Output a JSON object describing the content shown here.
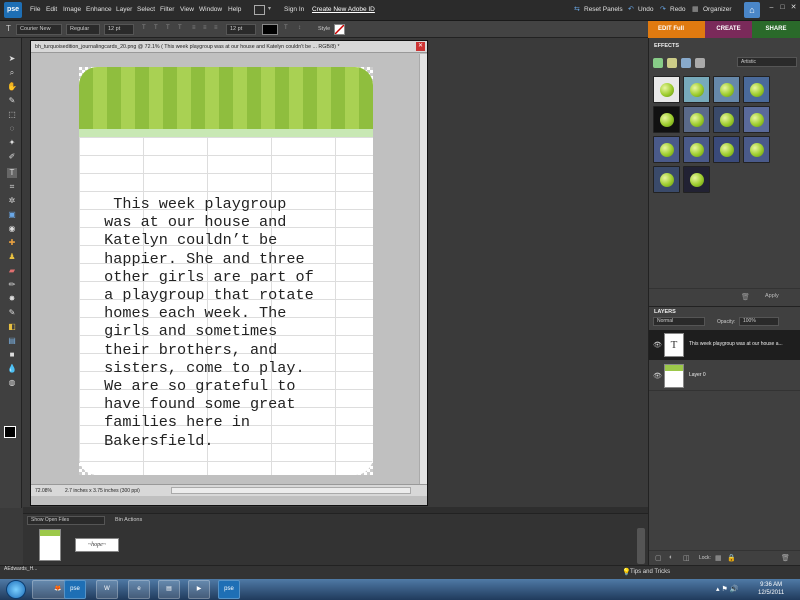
{
  "app": {
    "logo": "pse",
    "menus": [
      "File",
      "Edit",
      "Image",
      "Enhance",
      "Layer",
      "Select",
      "Filter",
      "View",
      "Window",
      "Help"
    ],
    "sign_in": "Sign In",
    "create_id": "Create New Adobe ID",
    "reset_panels": "Reset Panels",
    "undo": "Undo",
    "redo": "Redo",
    "organizer": "Organizer",
    "mode_tabs": [
      "EDIT Full",
      "CREATE",
      "SHARE"
    ]
  },
  "options": {
    "font_family": "Courier New",
    "font_style": "Regular",
    "font_size": "12 pt",
    "leading": "12 pt",
    "style_label": "Style"
  },
  "document": {
    "title": "bh_turquoisedition_journalingcards_20.png @ 72.1% ( This week playgroup was at our house and Katelyn couldn't be ... RGB/8) *",
    "zoom": "72.08%",
    "size": "2.7 inches x 3.75 inches (300 ppi)",
    "journal_text": "  This week playgroup\n was at our house and\n Katelyn couldn’t be\n happier. She and three\n other girls are part of\n a playgroup that rotate\n homes each week. The\n girls and sometimes\n their brothers, and\n sisters, come to play.\n We are so grateful to\n have found some great\n families here in\n Bakersfield."
  },
  "bin": {
    "select": "Show Open Files",
    "actions": "Bin Actions",
    "thumb2_text": "~hope~"
  },
  "effects": {
    "title": "EFFECTS",
    "category": "Artistic",
    "apply": "Apply"
  },
  "layers": {
    "title": "LAYERS",
    "blend": "Normal",
    "opacity_label": "Opacity:",
    "opacity": "100%",
    "items": [
      {
        "name": "This week playgroup was at our house a..."
      },
      {
        "name": "Layer 0"
      }
    ],
    "lock": "Lock:"
  },
  "status": {
    "tips": "Tips and Tricks"
  },
  "taskbar": {
    "task1": "AEdwards_H...",
    "time": "9:36 AM",
    "date": "12/5/2011"
  }
}
